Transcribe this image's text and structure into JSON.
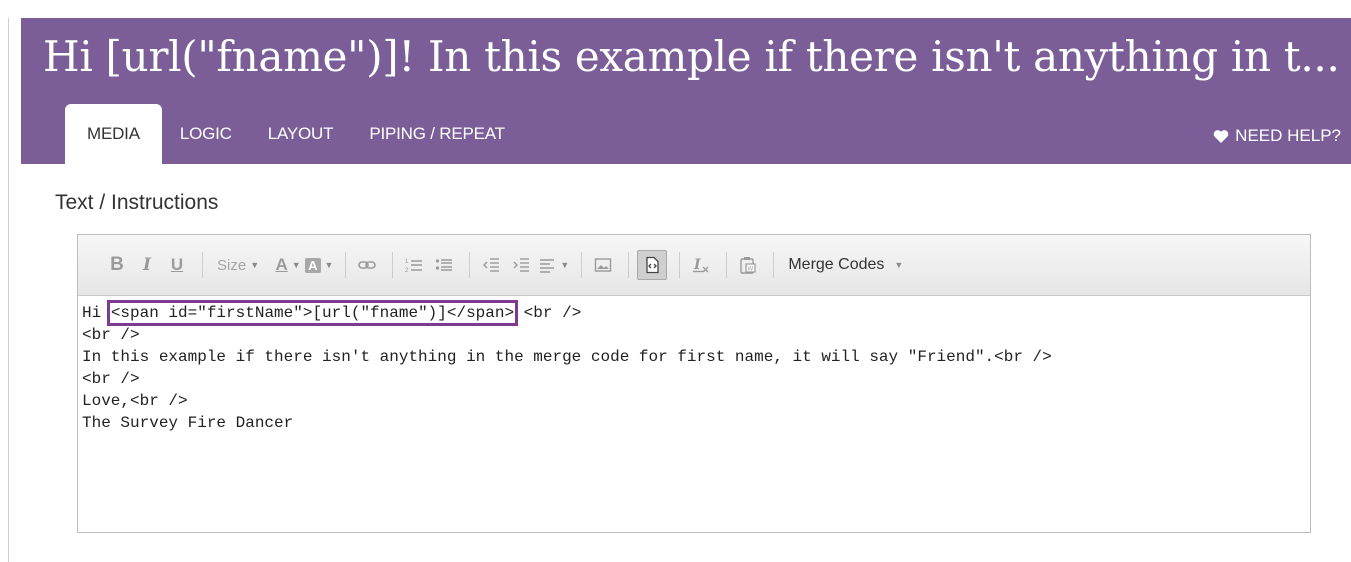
{
  "header": {
    "title": "Hi [url(\"fname\")]! In this example if there isn't anything in t...",
    "tabs": [
      {
        "label": "MEDIA",
        "active": true
      },
      {
        "label": "LOGIC",
        "active": false
      },
      {
        "label": "LAYOUT",
        "active": false
      },
      {
        "label": "PIPING / REPEAT",
        "active": false
      }
    ],
    "help_label": "NEED HELP?"
  },
  "section_label": "Text / Instructions",
  "toolbar": {
    "bold": "B",
    "italic": "I",
    "underline": "U",
    "size_label": "Size",
    "font_color_label": "A",
    "bg_color_label": "A",
    "merge_codes_label": "Merge Codes",
    "icons": [
      "bold-icon",
      "italic-icon",
      "underline-icon",
      "font-size-dropdown",
      "text-color-icon",
      "background-color-icon",
      "link-icon",
      "numbered-list-icon",
      "bulleted-list-icon",
      "outdent-icon",
      "indent-icon",
      "align-icon",
      "image-icon",
      "source-icon",
      "remove-format-icon",
      "paste-word-icon"
    ]
  },
  "editor": {
    "line1_prefix": "Hi ",
    "line1_highlight": "<span id=\"firstName\">[url(\"fname\")]</span>",
    "line1_suffix": " <br />",
    "lines": [
      "<br />",
      "In this example if there isn't anything in the merge code for first name, it will say \"Friend\".<br />",
      "<br />",
      "Love,<br />",
      "The Survey Fire Dancer"
    ]
  },
  "colors": {
    "header_bg": "#7b5e98",
    "highlight_border": "#7d3a8e"
  }
}
